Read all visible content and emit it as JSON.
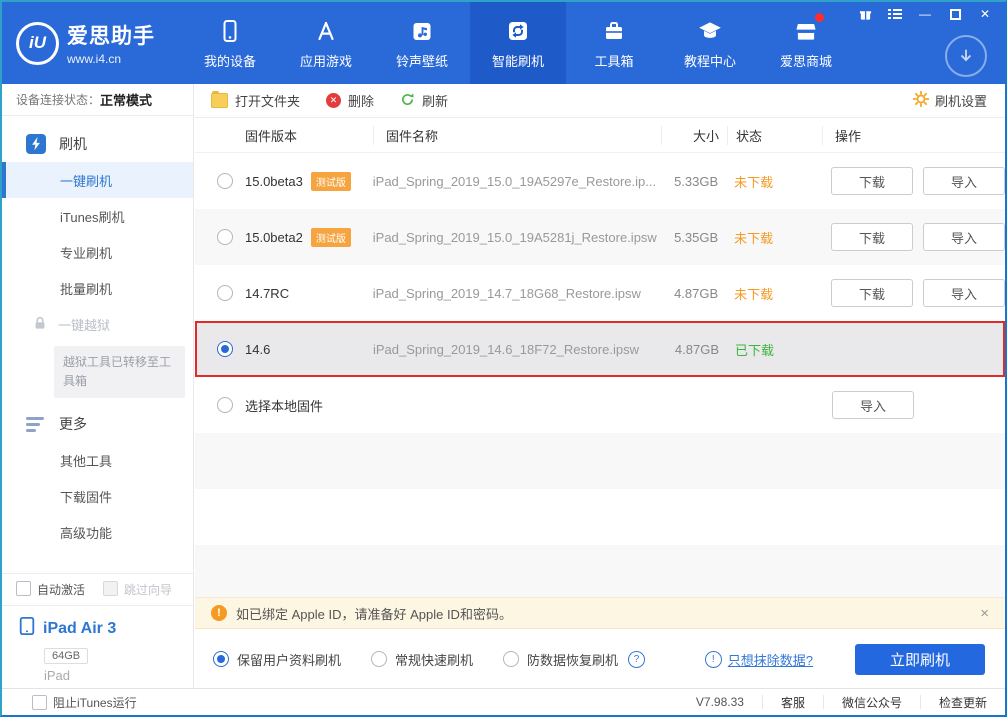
{
  "header": {
    "logo": {
      "mark": "iU",
      "title": "爱思助手",
      "url": "www.i4.cn"
    },
    "nav": [
      {
        "label": "我的设备",
        "icon": "device-icon",
        "active": false
      },
      {
        "label": "应用游戏",
        "icon": "appstore-icon",
        "active": false
      },
      {
        "label": "铃声壁纸",
        "icon": "ringtone-icon",
        "active": false
      },
      {
        "label": "智能刷机",
        "icon": "smart-flash-icon",
        "active": true
      },
      {
        "label": "工具箱",
        "icon": "toolbox-icon",
        "active": false
      },
      {
        "label": "教程中心",
        "icon": "tutorial-icon",
        "active": false
      },
      {
        "label": "爱思商城",
        "icon": "mall-icon",
        "active": false,
        "notification_dot": true
      }
    ],
    "window_controls": [
      "gift-icon",
      "list-icon",
      "minimize",
      "maximize",
      "close"
    ],
    "accent_color": "#2a69d8",
    "active_color": "#1f5bc8"
  },
  "sidebar": {
    "status_label": "设备连接状态：",
    "status_value": "正常模式",
    "groups": [
      {
        "label": "刷机",
        "icon": "flash-icon"
      },
      {
        "label": "更多",
        "icon": "more-icon"
      }
    ],
    "items": [
      {
        "label": "一键刷机",
        "active": true
      },
      {
        "label": "iTunes刷机"
      },
      {
        "label": "专业刷机"
      },
      {
        "label": "批量刷机"
      },
      {
        "label": "一键越狱",
        "disabled": true,
        "icon": "lock-icon"
      },
      {
        "label": "其他工具"
      },
      {
        "label": "下载固件"
      },
      {
        "label": "高级功能"
      }
    ],
    "jailbreak_note": "越狱工具已转移至工具箱",
    "checkboxes": [
      {
        "label": "自动激活",
        "checked": false
      },
      {
        "label": "跳过向导",
        "checked": false,
        "disabled": true
      }
    ],
    "device": {
      "name": "iPad Air 3",
      "capacity": "64GB",
      "type": "iPad",
      "icon": "tablet-icon"
    }
  },
  "toolbar": {
    "open_folder": "打开文件夹",
    "delete": "删除",
    "refresh": "刷新",
    "settings": "刷机设置"
  },
  "table": {
    "headers": {
      "version": "固件版本",
      "name": "固件名称",
      "size": "大小",
      "status": "状态",
      "operation": "操作"
    },
    "rows": [
      {
        "version": "15.0beta3",
        "badge": "测试版",
        "name": "iPad_Spring_2019_15.0_19A5297e_Restore.ip...",
        "size": "5.33GB",
        "status": "未下载",
        "download": "下载",
        "import": "导入",
        "selected": false
      },
      {
        "version": "15.0beta2",
        "badge": "测试版",
        "name": "iPad_Spring_2019_15.0_19A5281j_Restore.ipsw",
        "size": "5.35GB",
        "status": "未下载",
        "download": "下载",
        "import": "导入",
        "selected": false
      },
      {
        "version": "14.7RC",
        "name": "iPad_Spring_2019_14.7_18G68_Restore.ipsw",
        "size": "4.87GB",
        "status": "未下载",
        "download": "下载",
        "import": "导入",
        "selected": false
      },
      {
        "version": "14.6",
        "name": "iPad_Spring_2019_14.6_18F72_Restore.ipsw",
        "size": "4.87GB",
        "status": "已下载",
        "selected": true
      },
      {
        "version": "选择本地固件",
        "import": "导入",
        "selected": false
      }
    ],
    "status_colors": {
      "not_downloaded": "#f59a23",
      "downloaded": "#3cb53c"
    },
    "selected_border_color": "#e02b2b"
  },
  "notice": {
    "text": "如已绑定 Apple ID，请准备好 Apple ID和密码。",
    "close": "×",
    "icon": "warning-icon"
  },
  "flash_options": {
    "options": [
      {
        "label": "保留用户资料刷机",
        "selected": true
      },
      {
        "label": "常规快速刷机",
        "selected": false
      },
      {
        "label": "防数据恢复刷机",
        "selected": false,
        "help": true
      }
    ],
    "erase_link": "只想抹除数据?",
    "flash_button": "立即刷机"
  },
  "statusbar": {
    "block_itunes": "阻止iTunes运行",
    "version": "V7.98.33",
    "links": [
      "客服",
      "微信公众号",
      "检查更新"
    ]
  }
}
